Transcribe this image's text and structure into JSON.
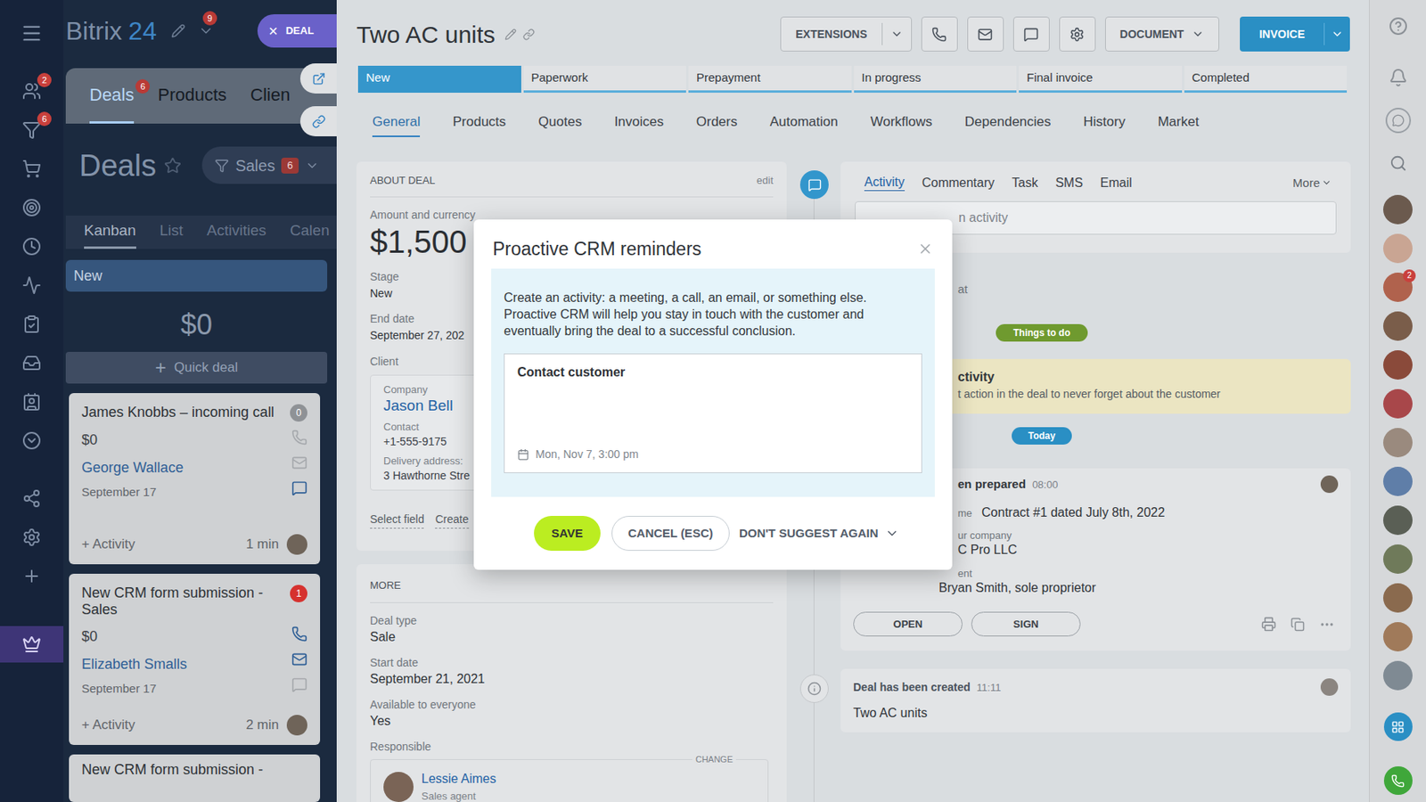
{
  "sidebar": {
    "items": [
      {
        "badge": "2"
      },
      {
        "badge": "6"
      },
      {
        "badge": ""
      },
      {
        "badge": ""
      },
      {
        "badge": ""
      },
      {
        "badge": ""
      },
      {
        "badge": ""
      },
      {
        "badge": ""
      },
      {
        "badge": ""
      },
      {
        "badge": ""
      },
      {
        "badge": ""
      },
      {
        "badge": ""
      },
      {
        "badge": ""
      }
    ]
  },
  "header": {
    "logo": "Bitrix",
    "logo_accent": "24",
    "notifications": "9",
    "chip": {
      "close": "×",
      "label": "DEAL"
    }
  },
  "crm_tabs": [
    {
      "label": "Deals",
      "badge": "6",
      "selected": true
    },
    {
      "label": "Products",
      "badge": "",
      "selected": false
    },
    {
      "label": "Clien",
      "badge": "",
      "selected": false
    }
  ],
  "page": {
    "title": "Deals",
    "filter": {
      "label": "Sales",
      "count": "6"
    }
  },
  "view_tabs": [
    {
      "label": "Kanban",
      "selected": true
    },
    {
      "label": "List",
      "selected": false
    },
    {
      "label": "Activities",
      "selected": false
    },
    {
      "label": "Calen",
      "selected": false
    }
  ],
  "kanban": {
    "column": "New",
    "total": "$0",
    "quick_add_icon": "+",
    "quick_add": "Quick deal",
    "cards": [
      {
        "title": "James Knobbs – incoming call",
        "badge": "0",
        "badge_color": "#8f9296",
        "amount": "$0",
        "client": "George Wallace",
        "date": "September 17",
        "activity": "+ Activity",
        "time": "1 min",
        "channels": [
          {
            "kind": "phone",
            "active": false
          },
          {
            "kind": "mail",
            "active": false
          },
          {
            "kind": "chat",
            "active": true
          }
        ]
      },
      {
        "title": "New CRM form submission - Sales",
        "badge": "1",
        "badge_color": "#d6322f",
        "amount": "$0",
        "client": "Elizabeth Smalls",
        "date": "September 17",
        "activity": "+ Activity",
        "time": "2 min",
        "channels": [
          {
            "kind": "phone",
            "active": true
          },
          {
            "kind": "mail",
            "active": true
          },
          {
            "kind": "chat",
            "active": false
          }
        ]
      }
    ],
    "cut_card": {
      "title": "New CRM form submission -"
    }
  },
  "deal": {
    "title": "Two AC units",
    "toolbar": {
      "extensions": "EXTENSIONS",
      "document": "DOCUMENT",
      "invoice": "INVOICE"
    },
    "stages": [
      {
        "label": "New",
        "selected": true
      },
      {
        "label": "Paperwork",
        "selected": false
      },
      {
        "label": "Prepayment",
        "selected": false
      },
      {
        "label": "In progress",
        "selected": false
      },
      {
        "label": "Final invoice",
        "selected": false
      },
      {
        "label": "Completed",
        "selected": false
      }
    ],
    "tabs": [
      {
        "label": "General",
        "selected": true
      },
      {
        "label": "Products",
        "selected": false
      },
      {
        "label": "Quotes",
        "selected": false
      },
      {
        "label": "Invoices",
        "selected": false
      },
      {
        "label": "Orders",
        "selected": false
      },
      {
        "label": "Automation",
        "selected": false
      },
      {
        "label": "Workflows",
        "selected": false
      },
      {
        "label": "Dependencies",
        "selected": false
      },
      {
        "label": "History",
        "selected": false
      },
      {
        "label": "Market",
        "selected": false
      }
    ],
    "about": {
      "heading": "ABOUT DEAL",
      "edit": "edit",
      "fields": [
        {
          "label": "Amount and currency",
          "value": "$1,500",
          "kind": "amount"
        },
        {
          "label": "Stage",
          "value": "New",
          "kind": "text"
        },
        {
          "label": "End date",
          "value": "September 27, 202",
          "kind": "text"
        }
      ],
      "client": {
        "label": "Client",
        "rows": [
          {
            "label": "Company",
            "value": "Jason Bell",
            "kind": "link"
          },
          {
            "label": "Contact",
            "value": "+1-555-9175",
            "kind": "text"
          },
          {
            "label": "Delivery address:",
            "value": "3 Hawthorne Stre",
            "kind": "text"
          }
        ]
      },
      "links": [
        "Select field",
        "Create"
      ]
    },
    "more": {
      "heading": "MORE",
      "fields": [
        {
          "label": "Deal type",
          "value": "Sale"
        },
        {
          "label": "Start date",
          "value": "September 21, 2021"
        },
        {
          "label": "Available to everyone",
          "value": "Yes"
        }
      ],
      "responsible": {
        "label": "Responsible",
        "change": "CHANGE",
        "name": "Lessie Aimes",
        "role": "Sales agent"
      }
    }
  },
  "stream": {
    "tabs": [
      {
        "label": "Activity",
        "selected": true
      },
      {
        "label": "Commentary",
        "selected": false
      },
      {
        "label": "Task",
        "selected": false
      },
      {
        "label": "SMS",
        "selected": false
      },
      {
        "label": "Email",
        "selected": false
      }
    ],
    "more": "More",
    "input_placeholder": "n activity",
    "filter_fragment": "at",
    "things_to_do": {
      "pill": "Things to do",
      "title": "ctivity",
      "text": "t action in the deal to never forget about the customer"
    },
    "today": "Today",
    "document": {
      "title": "en prepared",
      "time": "08:00",
      "name_label": "me",
      "name": "Contract #1 dated July 8th, 2022",
      "company_label": "ur company",
      "company": "C Pro LLC",
      "client_label": "ent",
      "client": "Bryan Smith, sole proprietor",
      "buttons": [
        "OPEN",
        "SIGN"
      ]
    },
    "created": {
      "title": "Deal has been created",
      "time": "11:11",
      "text": "Two AC units"
    }
  },
  "right_rail": {
    "avatars": [
      {
        "color": "#6b5a4e",
        "badge": ""
      },
      {
        "color": "#c9a593",
        "badge": ""
      },
      {
        "color": "#b0624d",
        "badge": "2"
      },
      {
        "color": "#7a5d4a",
        "badge": ""
      },
      {
        "color": "#8a4a3a",
        "badge": ""
      },
      {
        "color": "#a8474a",
        "badge": ""
      },
      {
        "color": "#9a8a7e",
        "badge": ""
      },
      {
        "color": "#5f7ea8",
        "badge": ""
      },
      {
        "color": "#5a5f55",
        "badge": ""
      },
      {
        "color": "#6f7a5a",
        "badge": ""
      },
      {
        "color": "#8a6a4e",
        "badge": ""
      },
      {
        "color": "#a07a5a",
        "badge": ""
      },
      {
        "color": "#7f8a93",
        "badge": ""
      }
    ]
  },
  "modal": {
    "title": "Proactive CRM reminders",
    "description": "Create an activity: a meeting, a call, an email, or something else. Proactive CRM will help you stay in touch with the customer and eventually bring the deal to a successful conclusion.",
    "activity_text": "Contact customer",
    "date": "Mon, Nov 7, 3:00 pm",
    "buttons": {
      "save": "SAVE",
      "cancel": "CANCEL (ESC)",
      "dont_suggest": "DON'T SUGGEST AGAIN"
    }
  }
}
